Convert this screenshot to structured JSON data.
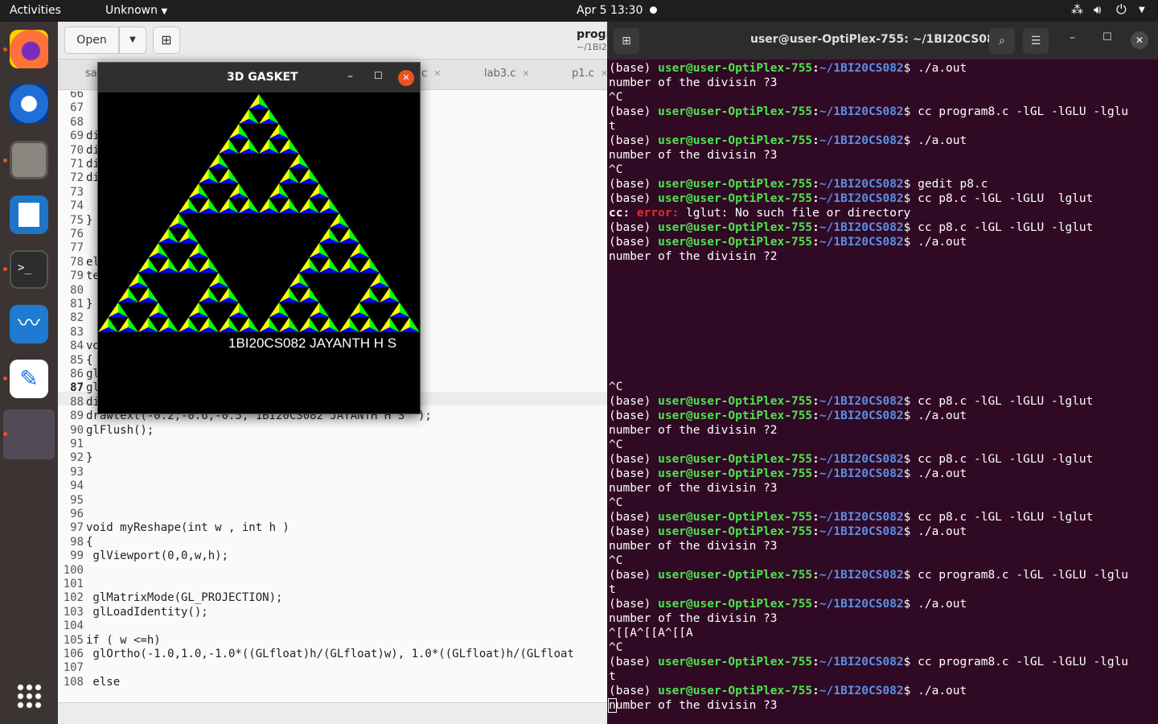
{
  "topbar": {
    "activities": "Activities",
    "app": "Unknown",
    "clock": "Apr 5  13:30"
  },
  "gedit": {
    "open_label": "Open",
    "title": "progr",
    "subtitle": "~/1BI2",
    "tabs": [
      "sa",
      ".c",
      "lab3.c",
      "p1.c"
    ]
  },
  "glwindow": {
    "title": "3D GASKET",
    "caption": "1BI20CS082 JAYANTH H S"
  },
  "terminal": {
    "title": "user@user-OptiPlex-755: ~/1BI20CS082"
  },
  "code_lines": [
    {
      "n": "66",
      "t": ""
    },
    {
      "n": "67",
      "t": ""
    },
    {
      "n": "68",
      "t": ""
    },
    {
      "n": "69",
      "t": "di"
    },
    {
      "n": "70",
      "t": "di"
    },
    {
      "n": "71",
      "t": "di"
    },
    {
      "n": "72",
      "t": "di"
    },
    {
      "n": "73",
      "t": ""
    },
    {
      "n": "74",
      "t": ""
    },
    {
      "n": "75",
      "t": "}"
    },
    {
      "n": "76",
      "t": ""
    },
    {
      "n": "77",
      "t": ""
    },
    {
      "n": "78",
      "t": "el"
    },
    {
      "n": "79",
      "t": "te"
    },
    {
      "n": "80",
      "t": ""
    },
    {
      "n": "81",
      "t": "}"
    },
    {
      "n": "82",
      "t": ""
    },
    {
      "n": "83",
      "t": ""
    },
    {
      "n": "84",
      "t": "vo"
    },
    {
      "n": "85",
      "t": "{"
    },
    {
      "n": "86",
      "t": "gl                                      IT);"
    },
    {
      "n": "87",
      "t": "gl"
    },
    {
      "n": "88",
      "t": "di"
    },
    {
      "n": "89",
      "t": "drawtext(-0.2,-0.6,-0.5,\"1BI20CS082 JAYANTH H S \");"
    },
    {
      "n": "90",
      "t": "glFlush();"
    },
    {
      "n": "91",
      "t": ""
    },
    {
      "n": "92",
      "t": "}"
    },
    {
      "n": "93",
      "t": ""
    },
    {
      "n": "94",
      "t": ""
    },
    {
      "n": "95",
      "t": ""
    },
    {
      "n": "96",
      "t": ""
    },
    {
      "n": "97",
      "t": "void myReshape(int w , int h )"
    },
    {
      "n": "98",
      "t": "{"
    },
    {
      "n": "99",
      "t": " glViewport(0,0,w,h);"
    },
    {
      "n": "100",
      "t": ""
    },
    {
      "n": "101",
      "t": ""
    },
    {
      "n": "102",
      "t": " glMatrixMode(GL_PROJECTION);"
    },
    {
      "n": "103",
      "t": " glLoadIdentity();"
    },
    {
      "n": "104",
      "t": ""
    },
    {
      "n": "105",
      "t": "if ( w <=h)"
    },
    {
      "n": "106",
      "t": " glOrtho(-1.0,1.0,-1.0*((GLfloat)h/(GLfloat)w), 1.0*((GLfloat)h/(GLfloat"
    },
    {
      "n": "107",
      "t": ""
    },
    {
      "n": "108",
      "t": " else"
    }
  ],
  "term_lines": [
    {
      "k": "p",
      "c": "./a.out"
    },
    {
      "k": "o",
      "c": "number of the divisin ?3"
    },
    {
      "k": "o",
      "c": "^C"
    },
    {
      "k": "p",
      "c": "cc program8.c -lGL -lGLU -lglu"
    },
    {
      "k": "o",
      "c": "t"
    },
    {
      "k": "p",
      "c": "./a.out"
    },
    {
      "k": "o",
      "c": "number of the divisin ?3"
    },
    {
      "k": "o",
      "c": "^C"
    },
    {
      "k": "p",
      "c": "gedit p8.c"
    },
    {
      "k": "p",
      "c": "cc p8.c -lGL -lGLU  lglut"
    },
    {
      "k": "e",
      "c": "lglut: No such file or directory"
    },
    {
      "k": "p",
      "c": "cc p8.c -lGL -lGLU -lglut"
    },
    {
      "k": "p",
      "c": "./a.out"
    },
    {
      "k": "o",
      "c": "number of the divisin ?2"
    },
    {
      "k": "o",
      "c": ""
    },
    {
      "k": "o",
      "c": ""
    },
    {
      "k": "o",
      "c": ""
    },
    {
      "k": "o",
      "c": ""
    },
    {
      "k": "o",
      "c": ""
    },
    {
      "k": "o",
      "c": ""
    },
    {
      "k": "o",
      "c": ""
    },
    {
      "k": "o",
      "c": ""
    },
    {
      "k": "o",
      "c": "^C"
    },
    {
      "k": "p",
      "c": "cc p8.c -lGL -lGLU -lglut"
    },
    {
      "k": "p",
      "c": "./a.out"
    },
    {
      "k": "o",
      "c": "number of the divisin ?2"
    },
    {
      "k": "o",
      "c": "^C"
    },
    {
      "k": "p",
      "c": "cc p8.c -lGL -lGLU -lglut"
    },
    {
      "k": "p",
      "c": "./a.out"
    },
    {
      "k": "o",
      "c": "number of the divisin ?3"
    },
    {
      "k": "o",
      "c": "^C"
    },
    {
      "k": "p",
      "c": "cc p8.c -lGL -lGLU -lglut"
    },
    {
      "k": "p",
      "c": "./a.out"
    },
    {
      "k": "o",
      "c": "number of the divisin ?3"
    },
    {
      "k": "o",
      "c": "^C"
    },
    {
      "k": "p",
      "c": "cc program8.c -lGL -lGLU -lglu"
    },
    {
      "k": "o",
      "c": "t"
    },
    {
      "k": "p",
      "c": "./a.out"
    },
    {
      "k": "o",
      "c": "number of the divisin ?3"
    },
    {
      "k": "o",
      "c": "^[[A^[[A^[[A"
    },
    {
      "k": "o",
      "c": "^C"
    },
    {
      "k": "p",
      "c": "cc program8.c -lGL -lGLU -lglu"
    },
    {
      "k": "o",
      "c": "t"
    },
    {
      "k": "p",
      "c": "./a.out"
    },
    {
      "k": "o",
      "c": "number of the divisin ?3"
    }
  ],
  "prompt": {
    "base": "(base) ",
    "userhost": "user@user-OptiPlex-755",
    "colon": ":",
    "path": "~/1BI20CS082",
    "dollar": "$ "
  },
  "error": {
    "prefix": "cc: ",
    "tag": "error: "
  },
  "colors": {
    "gasket_a": "#ffff00",
    "gasket_b": "#00ff00",
    "gasket_c": "#0000ff",
    "terminal_bg": "#300a24"
  }
}
